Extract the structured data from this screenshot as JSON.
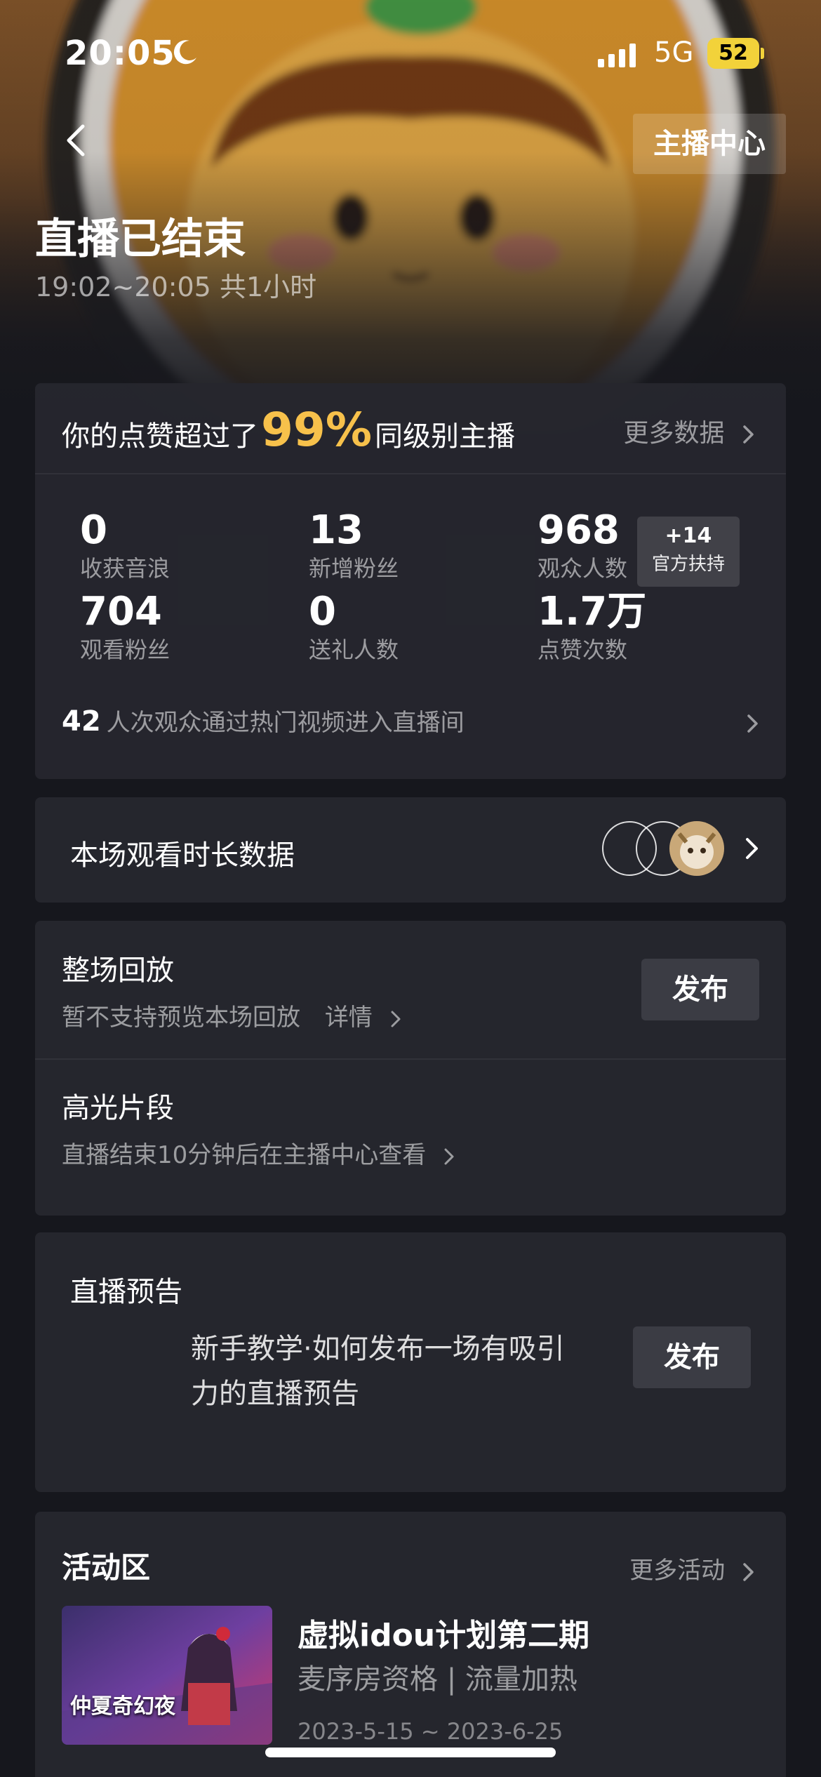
{
  "status_bar": {
    "time": "20:05",
    "network": "5G",
    "battery": "52"
  },
  "header": {
    "anchor_center_label": "主播中心",
    "title": "直播已结束",
    "subtitle": "19:02~20:05 共1小时"
  },
  "summary": {
    "prefix": "你的点赞超过了",
    "percent": "99%",
    "suffix": "同级别主播",
    "more_label": "更多数据",
    "stats": [
      {
        "value": "0",
        "label": "收获音浪"
      },
      {
        "value": "13",
        "label": "新增粉丝"
      },
      {
        "value": "968",
        "label": "观众人数"
      },
      {
        "value": "704",
        "label": "观看粉丝"
      },
      {
        "value": "0",
        "label": "送礼人数"
      },
      {
        "value": "1.7万",
        "label": "点赞次数"
      }
    ],
    "support_badge": {
      "top": "+14",
      "bottom": "官方扶持"
    },
    "hot_count": "42",
    "hot_text": "人次观众通过热门视频进入直播间"
  },
  "watch_duration": {
    "title": "本场观看时长数据"
  },
  "replay": {
    "full_title": "整场回放",
    "full_sub": "暂不支持预览本场回放",
    "details_label": "详情",
    "publish_label": "发布",
    "highlight_title": "高光片段",
    "highlight_sub": "直播结束10分钟后在主播中心查看"
  },
  "preview": {
    "title": "直播预告",
    "desc": "新手教学·如何发布一场有吸引力的直播预告",
    "publish_label": "发布"
  },
  "activity": {
    "title": "活动区",
    "more_label": "更多活动",
    "item": {
      "name": "虚拟idou计划第二期",
      "tags": "麦序房资格 | 流量加热",
      "date": "2023-5-15 ~ 2023-6-25",
      "thumb_text": "仲夏奇幻夜"
    }
  },
  "colors": {
    "accent": "#f7c14b",
    "card": "#25262d",
    "background": "#16171d"
  }
}
